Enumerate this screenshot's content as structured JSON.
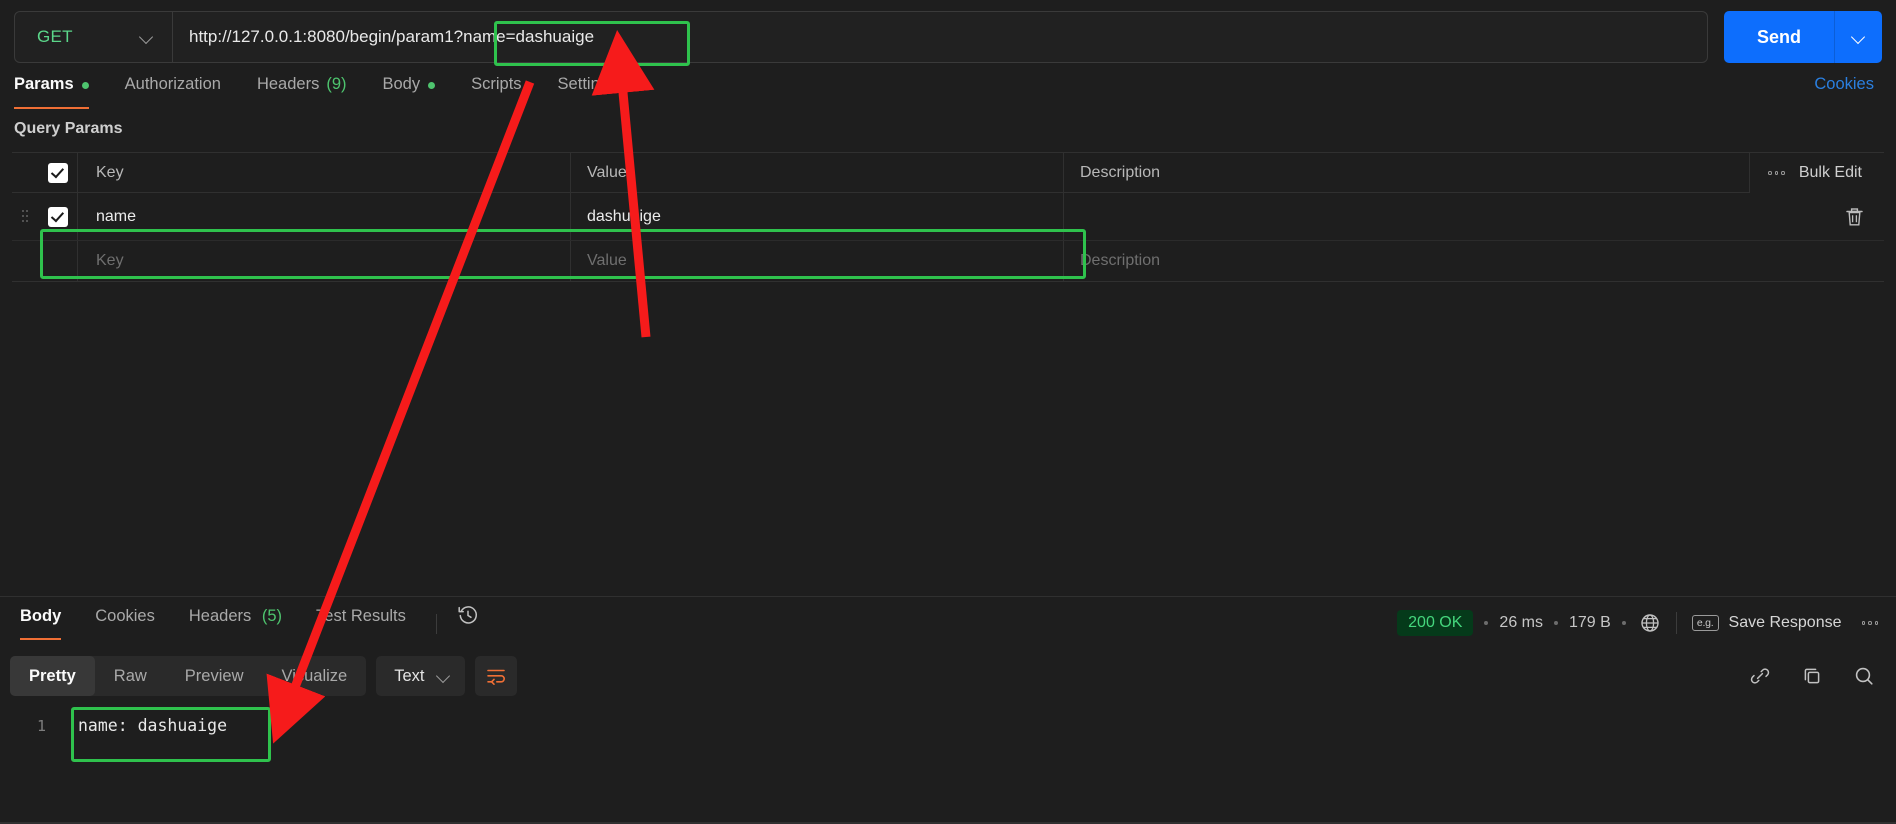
{
  "request": {
    "method": "GET",
    "url_prefix": "http://127.0.0.1:8080/begin/param1?",
    "url_query": "name=dashuaige",
    "url_full": "http://127.0.0.1:8080/begin/param1?name=dashuaige",
    "send_label": "Send"
  },
  "request_tabs": [
    {
      "label": "Params",
      "dot": true,
      "active": true
    },
    {
      "label": "Authorization",
      "dot": false,
      "active": false
    },
    {
      "label": "Headers",
      "count": "(9)",
      "active": false
    },
    {
      "label": "Body",
      "dot": true,
      "active": false
    },
    {
      "label": "Scripts",
      "active": false
    },
    {
      "label": "Settings",
      "active": false
    }
  ],
  "cookies_link": "Cookies",
  "query_params": {
    "title": "Query Params",
    "headers": {
      "key": "Key",
      "value": "Value",
      "description": "Description"
    },
    "bulk_edit": "Bulk Edit",
    "rows": [
      {
        "key": "name",
        "value": "dashuaige",
        "description": "",
        "checked": true
      }
    ],
    "placeholder_row": {
      "key": "Key",
      "value": "Value",
      "description": "Description"
    }
  },
  "response_tabs": [
    {
      "label": "Body",
      "active": true
    },
    {
      "label": "Cookies",
      "active": false
    },
    {
      "label": "Headers",
      "count": "(5)",
      "active": false
    },
    {
      "label": "Test Results",
      "active": false
    }
  ],
  "status": {
    "code": "200 OK",
    "time": "26 ms",
    "size": "179 B",
    "save_response": "Save Response",
    "eg_icon_label": "e.g."
  },
  "format_bar": {
    "modes": [
      {
        "label": "Pretty",
        "active": true
      },
      {
        "label": "Raw",
        "active": false
      },
      {
        "label": "Preview",
        "active": false
      },
      {
        "label": "Visualize",
        "active": false
      }
    ],
    "language": "Text"
  },
  "response_body": {
    "line_numbers": [
      "1"
    ],
    "lines": [
      "name: dashuaige"
    ]
  },
  "colors": {
    "accent_orange": "#f06f35",
    "send_blue": "#0d6efd",
    "method_green": "#5bd78a",
    "status_green": "#45d67d",
    "link_blue": "#2a7fe0",
    "annotation_green": "#2fc24d",
    "annotation_red": "#f61b1b",
    "background": "#1e1e1e"
  }
}
